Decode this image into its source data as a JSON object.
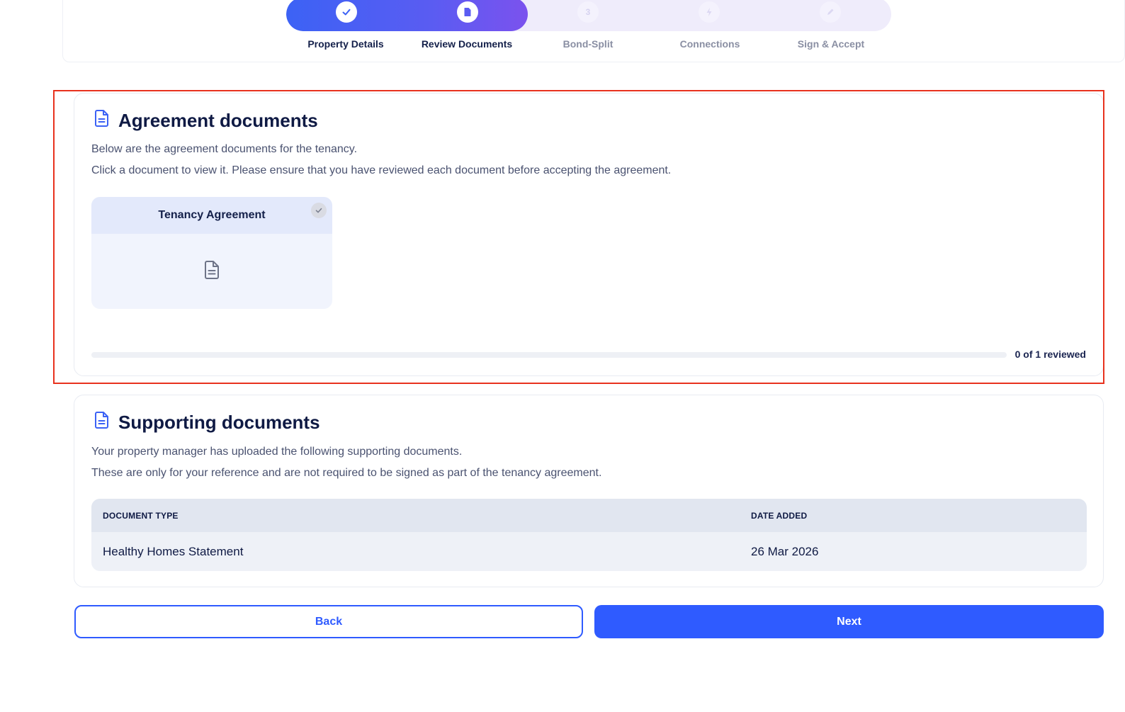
{
  "stepper": {
    "progress_fraction": 0.4,
    "steps": [
      {
        "label": "Property Details",
        "status": "done",
        "icon": "check-icon"
      },
      {
        "label": "Review Documents",
        "status": "current",
        "icon": "document-icon"
      },
      {
        "label": "Bond-Split",
        "status": "pending",
        "number": "3"
      },
      {
        "label": "Connections",
        "status": "pending",
        "icon": "lightning-icon"
      },
      {
        "label": "Sign & Accept",
        "status": "pending",
        "icon": "pencil-icon"
      }
    ]
  },
  "agreement": {
    "title": "Agreement documents",
    "line1": "Below are the agreement documents for the tenancy.",
    "line2": "Click a document to view it. Please ensure that you have reviewed each document before accepting the agreement.",
    "documents": [
      {
        "name": "Tenancy Agreement",
        "reviewed": false
      }
    ],
    "progress_text": "0 of 1 reviewed",
    "progress_fraction": 0
  },
  "supporting": {
    "title": "Supporting documents",
    "line1": "Your property manager has uploaded the following supporting documents.",
    "line2": "These are only for your reference and are not required to be signed as part of the tenancy agreement.",
    "columns": [
      "DOCUMENT TYPE",
      "DATE ADDED"
    ],
    "rows": [
      [
        "Healthy Homes Statement",
        "26 Mar 2026"
      ]
    ]
  },
  "actions": {
    "back_label": "Back",
    "next_label": "Next"
  },
  "colors": {
    "accent": "#2f5bff",
    "highlight": "#e8321e"
  }
}
